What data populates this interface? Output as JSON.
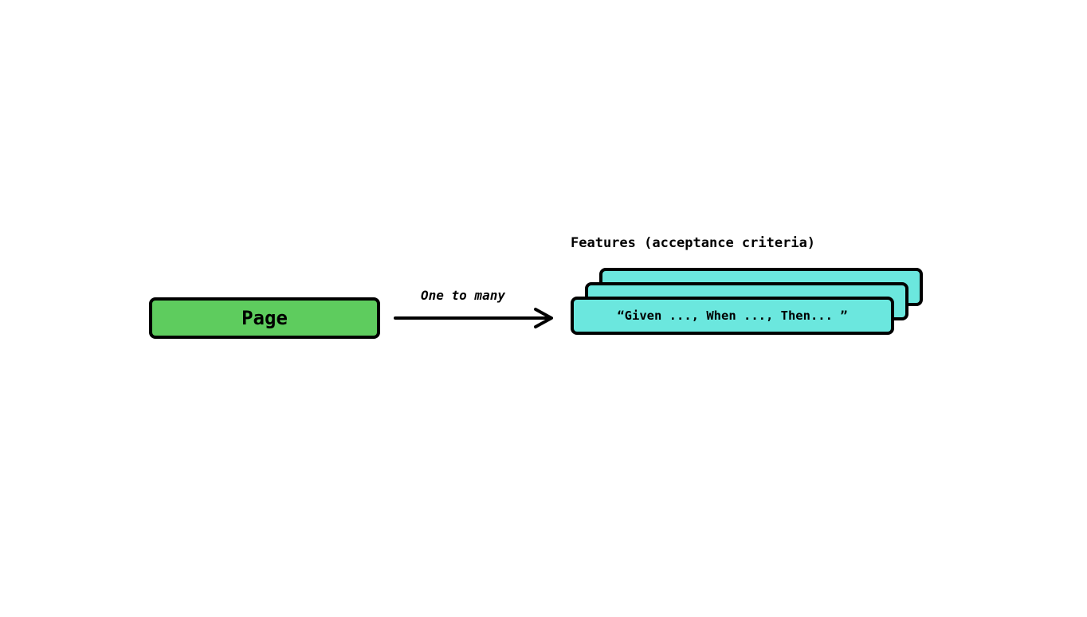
{
  "left_box": {
    "label": "Page"
  },
  "arrow": {
    "label": "One to many"
  },
  "right_stack": {
    "title": "Features (acceptance criteria)",
    "front_card_text": "“Given ..., When ..., Then... ”"
  },
  "colors": {
    "page_fill": "#5ecc5e",
    "feature_fill": "#6be7de",
    "stroke": "#000000",
    "background": "#ffffff"
  }
}
